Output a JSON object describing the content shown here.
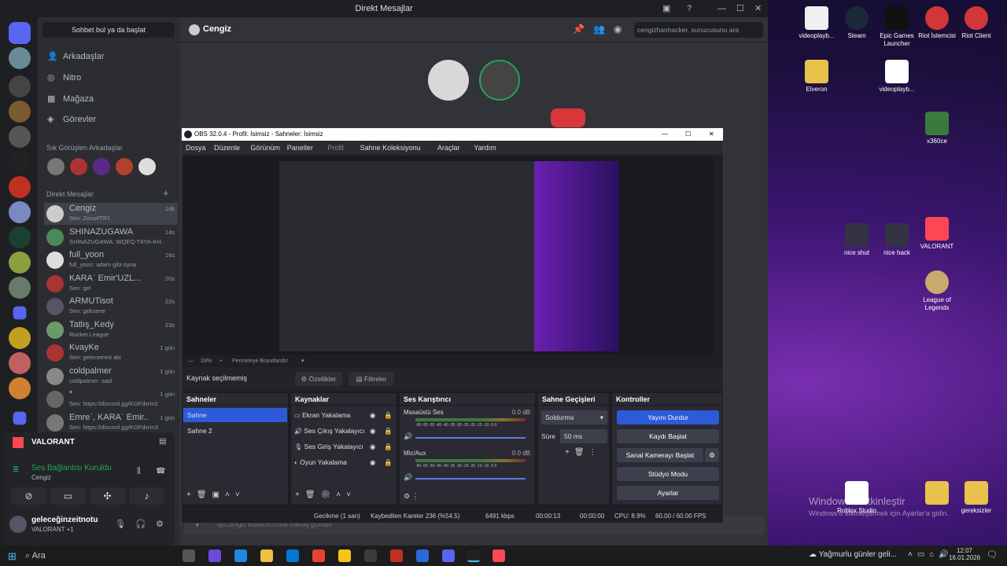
{
  "desktop": {
    "icons": [
      {
        "label": "videoplayb...",
        "color": "#f0f0f0"
      },
      {
        "label": "Steam",
        "color": "#1b2838"
      },
      {
        "label": "Epic Games Launcher",
        "color": "#111111"
      },
      {
        "label": "Riot İstemcisi",
        "color": "#d13639"
      },
      {
        "label": "Riot Client",
        "color": "#d13639"
      },
      {
        "label": "Elveron",
        "color": "#e8c24a"
      },
      {
        "label": "videoplayb...",
        "color": "#ffffff"
      },
      {
        "label": "x360ce",
        "color": "#3a7a3a"
      },
      {
        "label": "nice shut",
        "color": "#334"
      },
      {
        "label": "nice hack",
        "color": "#334"
      },
      {
        "label": "VALORANT",
        "color": "#ff4655"
      },
      {
        "label": "League of Legends",
        "color": "#c8aa6e"
      },
      {
        "label": "Roblox Studio",
        "color": "#ffffff"
      },
      {
        "label": "",
        "color": "#e8c24a"
      },
      {
        "label": "gereksizler",
        "color": "#e8c24a"
      }
    ],
    "watermark_title": "Windows'u Etkinleştir",
    "watermark_sub": "Windows'u etkinleştirmek için Ayarlar'a gidin."
  },
  "discord": {
    "window_title": "Direkt Mesajlar",
    "search_button": "Sohbet bul ya da başlat",
    "nav": [
      {
        "label": "Arkadaşlar",
        "icon": "friends-icon"
      },
      {
        "label": "Nitro",
        "icon": "nitro-icon"
      },
      {
        "label": "Mağaza",
        "icon": "shop-icon"
      },
      {
        "label": "Görevler",
        "icon": "quests-icon"
      }
    ],
    "frequent_header": "Sık Görüşlen Arkadaşlar",
    "dm_header": "Direkt Mesajlar",
    "dms": [
      {
        "name": "Cengiz",
        "sub": "Sen: Zeus#TR1",
        "time": "1dk"
      },
      {
        "name": "SHINAZUGAWA",
        "sub": "SHINAZUGAWA: WQEQ-T4YA-KH...",
        "time": "14s"
      },
      {
        "name": "full_yoon",
        "sub": "full_yoon: adam gibi oyna",
        "time": "16s"
      },
      {
        "name": "KARAʿ Emir'UZL...",
        "sub": "Sen: gel",
        "time": "20s"
      },
      {
        "name": "ARMUTisot",
        "sub": "Sen: geksene",
        "time": "22s"
      },
      {
        "name": "Tatlış_Kedy",
        "sub": "Rocket League",
        "time": "23s"
      },
      {
        "name": "KvayKe",
        "sub": "Sen: gelecemmi abi",
        "time": "1 gün"
      },
      {
        "name": "coldpalmer",
        "sub": "coldpalmer: saol",
        "time": "1 gün"
      },
      {
        "name": "*",
        "sub": "Sen: https://discord.gg/KGFdxrm2",
        "time": "1 gün"
      },
      {
        "name": "Emreʿ, KARAʿ Emir...",
        "sub": "Sen: https://discord.gg/KGFdxrm3",
        "time": "1 gün"
      }
    ],
    "game": "VALORANT",
    "voice_status": "Ses Bağlantısı Kuruldu",
    "voice_channel": "Cengiz",
    "user_name": "geleceğinzeitnotu",
    "user_status": "VALORANT +1",
    "chat_name": "Cengiz",
    "chat_search_placeholder": "cengizhanhacker. sunucusunu ara",
    "message_placeholder": "@Cengiz kullanıcısına mesaj gönder"
  },
  "obs": {
    "title": "OBS 32.0.4 - Profil: İsimsiz - Sahneler: İsimsiz",
    "menu": [
      "Dosya",
      "Düzenle",
      "Görünüm",
      "Paneller",
      "Profil",
      "Sahne Koleksiyonu",
      "Araçlar",
      "Yardım"
    ],
    "zoom": "33%",
    "fit_label": "Pencereye Boyutlandır",
    "no_source": "Kaynak seçilmemiş",
    "properties": "Özellikler",
    "filters": "Filtreler",
    "scenes_header": "Sahneler",
    "scenes": [
      "Sahne",
      "Sahne 2"
    ],
    "sources_header": "Kaynaklar",
    "sources": [
      "Ekran Yakalama",
      "Ses Çıkış Yakalayıcı",
      "Ses Giriş Yakalayıcı",
      "Oyun Yakalama"
    ],
    "mixer_header": "Ses Karıştırıcı",
    "mixer": [
      {
        "name": "Masaüstü Ses",
        "db": "0.0 dB"
      },
      {
        "name": "Mic/Aux",
        "db": "0.0 dB"
      }
    ],
    "meter_ticks": "-60 -55 -50 -45 -40 -35 -30 -25 -20 -15 -10 -5 0",
    "transitions_header": "Sahne Geçişleri",
    "transition": "Soldurma",
    "duration_label": "Süre",
    "duration": "50 ms",
    "controls_header": "Kontroller",
    "controls": [
      "Yayını Durdur",
      "Kaydı Başlat",
      "Sanal Kamerayı Başlat",
      "Stüdyo Modu",
      "Ayarlar"
    ],
    "status": {
      "delay": "Gecikme (1 san)",
      "dropped": "Kaybedilen Kareler 236 (%54.5)",
      "kbps": "6491 kbps",
      "stream_time": "00:00:13",
      "rec_time": "00:00:00",
      "cpu": "CPU: 8.9%",
      "fps": "60.00 / 60.00 FPS"
    }
  },
  "taskbar": {
    "search": "Ara",
    "weather": "Yağmurlu günler geli...",
    "time": "12:07",
    "date": "16.01.2026"
  }
}
